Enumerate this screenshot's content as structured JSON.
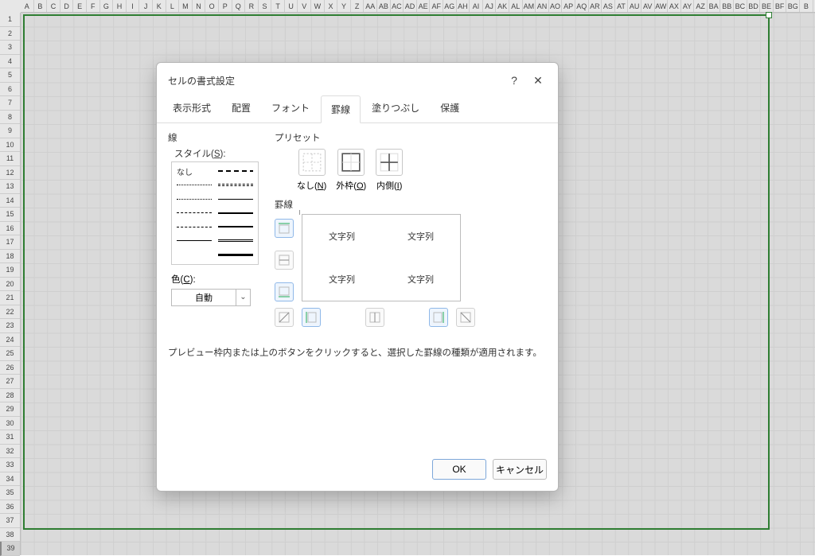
{
  "columns": [
    "A",
    "B",
    "C",
    "D",
    "E",
    "F",
    "G",
    "H",
    "I",
    "J",
    "K",
    "L",
    "M",
    "N",
    "O",
    "P",
    "Q",
    "R",
    "S",
    "T",
    "U",
    "V",
    "W",
    "X",
    "Y",
    "Z",
    "AA",
    "AB",
    "AC",
    "AD",
    "AE",
    "AF",
    "AG",
    "AH",
    "AI",
    "AJ",
    "AK",
    "AL",
    "AM",
    "AN",
    "AO",
    "AP",
    "AQ",
    "AR",
    "AS",
    "AT",
    "AU",
    "AV",
    "AW",
    "AX",
    "AY",
    "AZ",
    "BA",
    "BB",
    "BC",
    "BD",
    "BE",
    "BF",
    "BG",
    "B"
  ],
  "rows_start": 1,
  "rows_end": 39,
  "dialog": {
    "title": "セルの書式設定",
    "help": "?",
    "close": "✕",
    "tabs": [
      "表示形式",
      "配置",
      "フォント",
      "罫線",
      "塗りつぶし",
      "保護"
    ],
    "active_tab": "罫線",
    "line_section": "線",
    "style_label": "スタイル(S):",
    "style_none": "なし",
    "color_label": "色(C):",
    "color_value": "自動",
    "preset_section": "プリセット",
    "presets": {
      "none": "なし(N)",
      "outer": "外枠(O)",
      "inner": "内側(I)"
    },
    "border_section": "罫線",
    "preview_text": "文字列",
    "note": "プレビュー枠内または上のボタンをクリックすると、選択した罫線の種類が適用されます。",
    "ok": "OK",
    "cancel": "キャンセル"
  }
}
